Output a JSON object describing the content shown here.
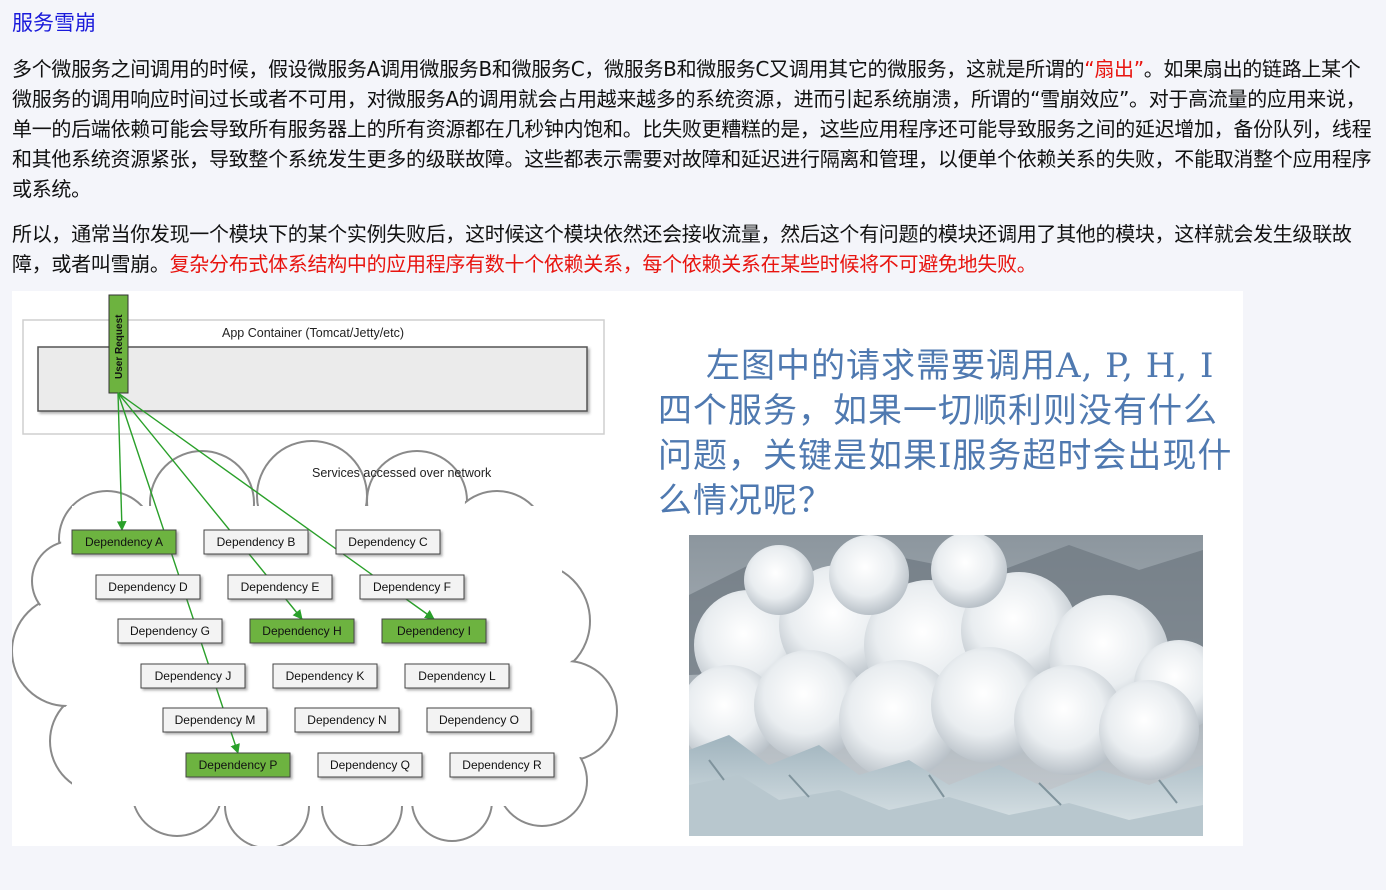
{
  "page": {
    "title": "服务雪崩",
    "paragraph1": {
      "before": "多个微服务之间调用的时候，假设微服务A调用微服务B和微服务C，微服务B和微服务C又调用其它的微服务，这就是所谓的",
      "highlight": "“扇出”",
      "after": "。如果扇出的链路上某个微服务的调用响应时间过长或者不可用，对微服务A的调用就会占用越来越多的系统资源，进而引起系统崩溃，所谓的“雪崩效应”。对于高流量的应用来说，单一的后端依赖可能会导致所有服务器上的所有资源都在几秒钟内饱和。比失败更糟糕的是，这些应用程序还可能导致服务之间的延迟增加，备份队列，线程和其他系统资源紧张，导致整个系统发生更多的级联故障。这些都表示需要对故障和延迟进行隔离和管理，以便单个依赖关系的失败，不能取消整个应用程序或系统。"
    },
    "paragraph2": {
      "before": "所以，通常当你发现一个模块下的某个实例失败后，这时候这个模块依然还会接收流量，然后这个有问题的模块还调用了其他的模块，这样就会发生级联故障，或者叫雪崩。",
      "highlight": "复杂分布式体系结构中的应用程序有数十个依赖关系，每个依赖关系在某些时候将不可避免地失败。"
    },
    "highlight_color": "#e8140f",
    "title_color": "#1a1adb"
  },
  "diagram": {
    "container_label": "App Container (Tomcat/Jetty/etc)",
    "user_request_label": "User Request",
    "network_label": "Services accessed over network",
    "dependencies": [
      {
        "label": "Dependency A",
        "active": true
      },
      {
        "label": "Dependency B",
        "active": false
      },
      {
        "label": "Dependency C",
        "active": false
      },
      {
        "label": "Dependency D",
        "active": false
      },
      {
        "label": "Dependency E",
        "active": false
      },
      {
        "label": "Dependency F",
        "active": false
      },
      {
        "label": "Dependency G",
        "active": false
      },
      {
        "label": "Dependency H",
        "active": true
      },
      {
        "label": "Dependency I",
        "active": true
      },
      {
        "label": "Dependency J",
        "active": false
      },
      {
        "label": "Dependency K",
        "active": false
      },
      {
        "label": "Dependency L",
        "active": false
      },
      {
        "label": "Dependency M",
        "active": false
      },
      {
        "label": "Dependency N",
        "active": false
      },
      {
        "label": "Dependency O",
        "active": false
      },
      {
        "label": "Dependency P",
        "active": true
      },
      {
        "label": "Dependency Q",
        "active": false
      },
      {
        "label": "Dependency R",
        "active": false
      }
    ],
    "active_color": "#6db33f",
    "arrow_color": "#2aa02a"
  },
  "side": {
    "question": "左图中的请求需要调用A, P, H, I四个服务，如果一切顺利则没有什么问题，关键是如果I服务超时会出现什么情况呢？",
    "text_color": "#4f79b0",
    "photo_subject": "avalanche-photo"
  }
}
